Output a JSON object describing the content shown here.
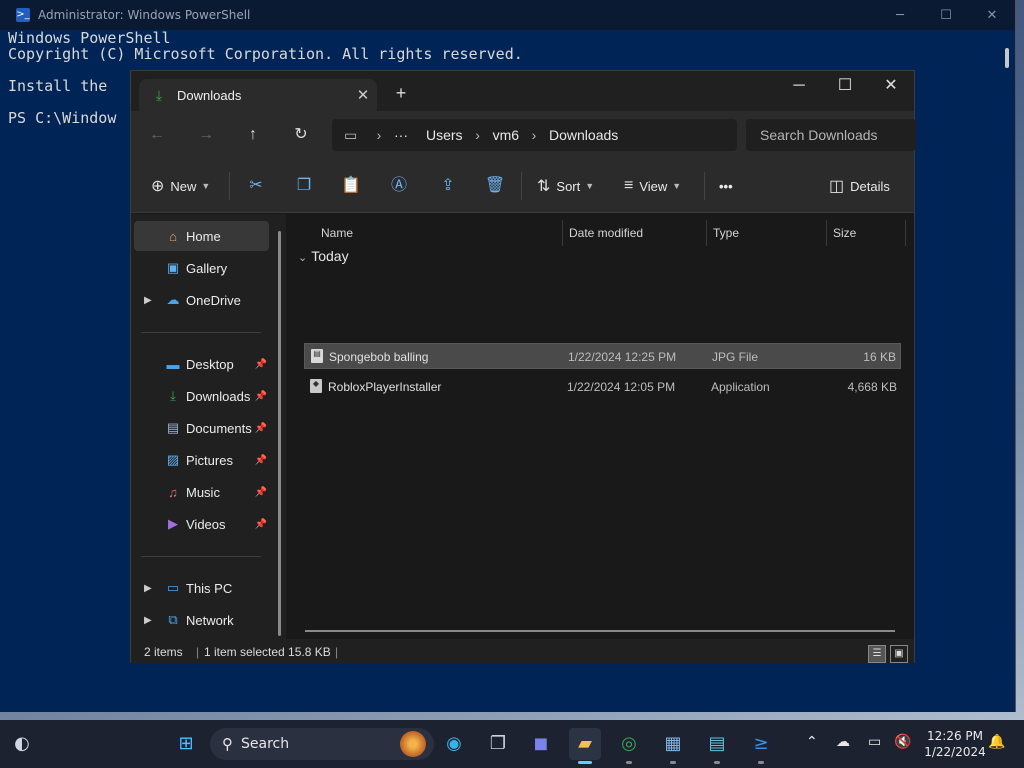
{
  "powershell": {
    "title": "Administrator: Windows PowerShell",
    "lines": [
      "Windows PowerShell",
      "Copyright (C) Microsoft Corporation. All rights reserved.",
      "",
      "Install the",
      "",
      "PS C:\\Window"
    ],
    "controls": {
      "minimize": "─",
      "maximize": "☐",
      "close": "✕"
    }
  },
  "explorer": {
    "tab": {
      "label": "Downloads",
      "close": "✕"
    },
    "new_tab": "+",
    "controls": {
      "minimize": "─",
      "maximize": "☐",
      "close": "✕"
    },
    "nav": {
      "back": "←",
      "forward": "→",
      "up": "↑",
      "refresh": "↻"
    },
    "breadcrumb": [
      "Users",
      "vm6",
      "Downloads"
    ],
    "breadcrumb_more": "···",
    "search_placeholder": "Search Downloads",
    "commands": {
      "new": "New",
      "sort": "Sort",
      "view": "View",
      "more": "•••",
      "details": "Details"
    },
    "nav_pane": {
      "top": [
        {
          "label": "Home",
          "icon": "home-icon"
        },
        {
          "label": "Gallery",
          "icon": "gallery-icon"
        },
        {
          "label": "OneDrive",
          "icon": "cloud-icon"
        }
      ],
      "pinned": [
        {
          "label": "Desktop",
          "icon": "desktop-icon"
        },
        {
          "label": "Downloads",
          "icon": "download-icon"
        },
        {
          "label": "Documents",
          "icon": "document-icon"
        },
        {
          "label": "Pictures",
          "icon": "pictures-icon"
        },
        {
          "label": "Music",
          "icon": "music-icon"
        },
        {
          "label": "Videos",
          "icon": "videos-icon"
        }
      ],
      "bottom": [
        {
          "label": "This PC",
          "icon": "computer-icon"
        },
        {
          "label": "Network",
          "icon": "network-icon"
        }
      ]
    },
    "columns": [
      "Name",
      "Date modified",
      "Type",
      "Size"
    ],
    "group": "Today",
    "files": [
      {
        "name": "Spongebob balling",
        "date": "1/22/2024 12:25 PM",
        "type": "JPG File",
        "size": "16 KB",
        "selected": true
      },
      {
        "name": "RobloxPlayerInstaller",
        "date": "1/22/2024 12:05 PM",
        "type": "Application",
        "size": "4,668 KB",
        "selected": false
      }
    ],
    "status": {
      "items": "2 items",
      "selection": "1 item selected  15.8 KB"
    }
  },
  "taskbar": {
    "search_label": "Search",
    "clock_time": "12:26 PM",
    "clock_date": "1/22/2024",
    "accent": "#60cdff"
  }
}
